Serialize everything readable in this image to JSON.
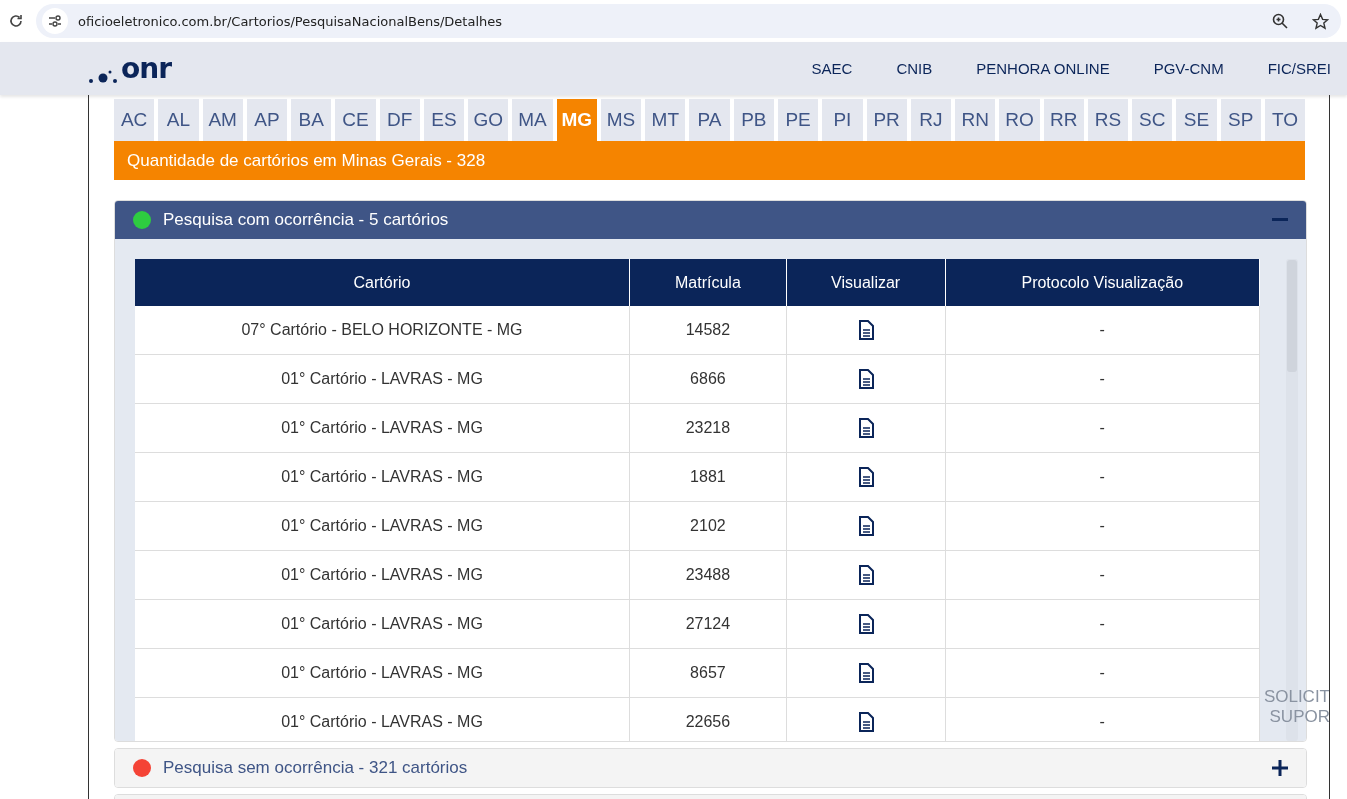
{
  "browser": {
    "url": "oficioeletronico.com.br/Cartorios/PesquisaNacionalBens/Detalhes"
  },
  "header": {
    "logo": "onr",
    "nav": [
      "SAEC",
      "CNIB",
      "PENHORA ONLINE",
      "PGV-CNM",
      "FIC/SREI"
    ]
  },
  "state_tabs": [
    {
      "label": "AC",
      "selected": false
    },
    {
      "label": "AL",
      "selected": false
    },
    {
      "label": "AM",
      "selected": false
    },
    {
      "label": "AP",
      "selected": false
    },
    {
      "label": "BA",
      "selected": false
    },
    {
      "label": "CE",
      "selected": false
    },
    {
      "label": "DF",
      "selected": false
    },
    {
      "label": "ES",
      "selected": false
    },
    {
      "label": "GO",
      "selected": false
    },
    {
      "label": "MA",
      "selected": false
    },
    {
      "label": "MG",
      "selected": true
    },
    {
      "label": "MS",
      "selected": false
    },
    {
      "label": "MT",
      "selected": false
    },
    {
      "label": "PA",
      "selected": false
    },
    {
      "label": "PB",
      "selected": false
    },
    {
      "label": "PE",
      "selected": false
    },
    {
      "label": "PI",
      "selected": false
    },
    {
      "label": "PR",
      "selected": false
    },
    {
      "label": "RJ",
      "selected": false
    },
    {
      "label": "RN",
      "selected": false
    },
    {
      "label": "RO",
      "selected": false
    },
    {
      "label": "RR",
      "selected": false
    },
    {
      "label": "RS",
      "selected": false
    },
    {
      "label": "SC",
      "selected": false
    },
    {
      "label": "SE",
      "selected": false
    },
    {
      "label": "SP",
      "selected": false
    },
    {
      "label": "TO",
      "selected": false
    }
  ],
  "count_banner": "Quantidade de cartórios em Minas Gerais - 328",
  "sections": [
    {
      "title": "Pesquisa com ocorrência - 5 cartórios",
      "color": "#2ecc40",
      "expanded": true,
      "table": {
        "columns": [
          "Cartório",
          "Matrícula",
          "Visualizar",
          "Protocolo Visualização"
        ],
        "rows": [
          [
            "07° Cartório - BELO HORIZONTE - MG",
            "14582",
            "-"
          ],
          [
            "01° Cartório - LAVRAS - MG",
            "6866",
            "-"
          ],
          [
            "01° Cartório - LAVRAS - MG",
            "23218",
            "-"
          ],
          [
            "01° Cartório - LAVRAS - MG",
            "1881",
            "-"
          ],
          [
            "01° Cartório - LAVRAS - MG",
            "2102",
            "-"
          ],
          [
            "01° Cartório - LAVRAS - MG",
            "23488",
            "-"
          ],
          [
            "01° Cartório - LAVRAS - MG",
            "27124",
            "-"
          ],
          [
            "01° Cartório - LAVRAS - MG",
            "8657",
            "-"
          ],
          [
            "01° Cartório - LAVRAS - MG",
            "22656",
            "-"
          ]
        ]
      }
    },
    {
      "title": "Pesquisa sem ocorrência - 321 cartórios",
      "color": "#f44336",
      "expanded": false
    }
  ],
  "support_tab": [
    "SOLICIT",
    "SUPOR"
  ]
}
